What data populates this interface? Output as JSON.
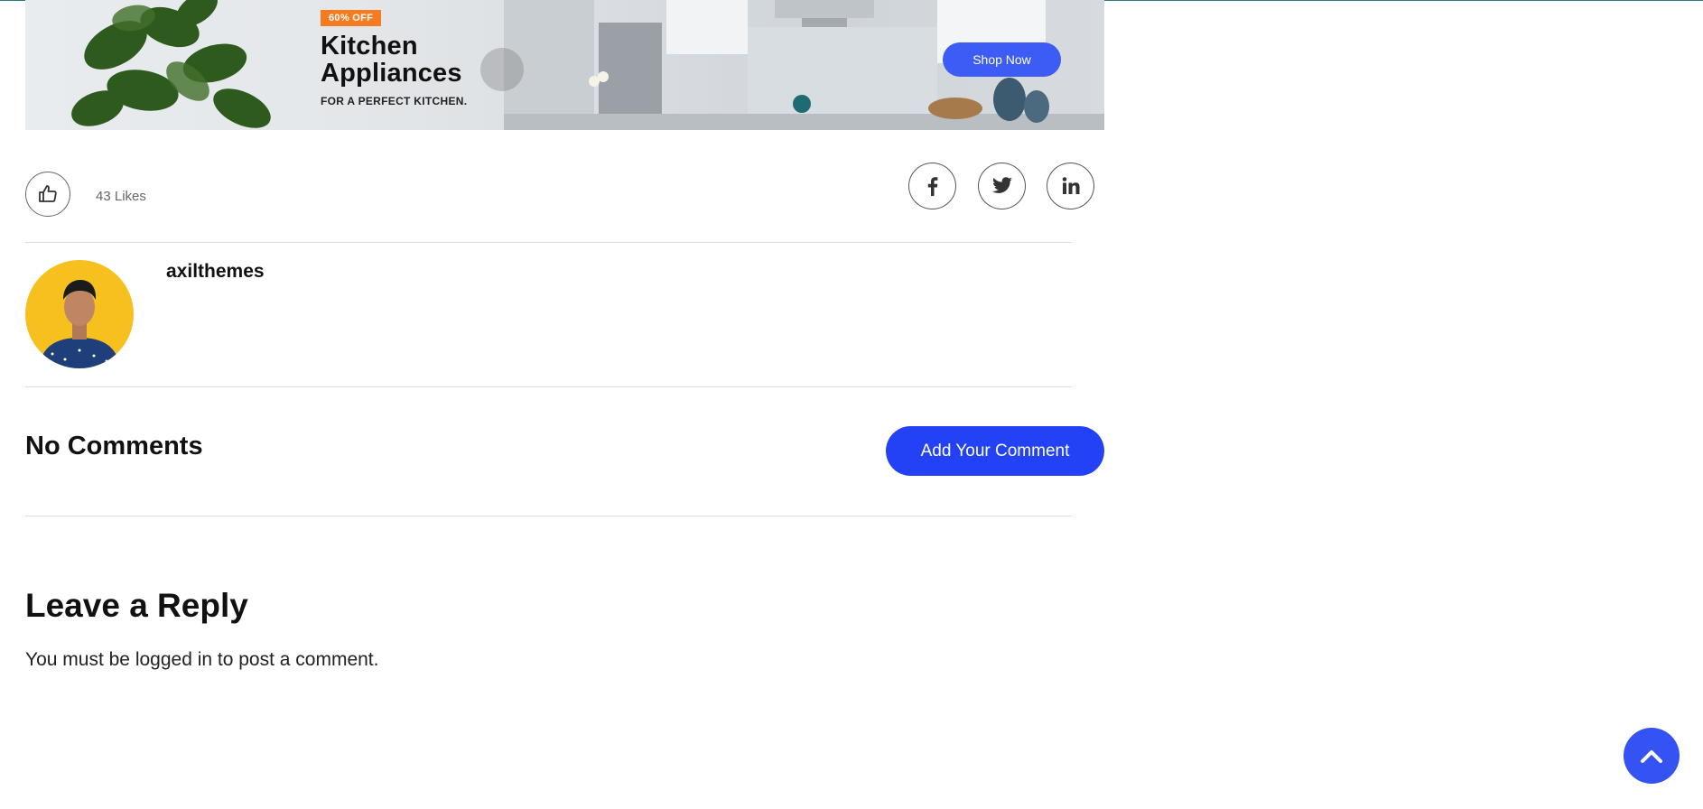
{
  "banner": {
    "badge": "60% OFF",
    "title_line1": "Kitchen",
    "title_line2": "Appliances",
    "subtitle": "FOR A PERFECT KITCHEN.",
    "cta": "Shop Now"
  },
  "post": {
    "likes_text": "43 Likes",
    "share": [
      "facebook-icon",
      "twitter-icon",
      "linkedin-icon"
    ]
  },
  "author": {
    "name": "axilthemes"
  },
  "comments": {
    "title": "No Comments",
    "add_button": "Add Your Comment"
  },
  "reply": {
    "title": "Leave a Reply",
    "note_prefix": "You must be ",
    "note_link": "logged in",
    "note_suffix": " to post a comment."
  },
  "colors": {
    "accent": "#2342f5",
    "badge": "#f47b20",
    "avatar_bg": "#f6c01e"
  }
}
